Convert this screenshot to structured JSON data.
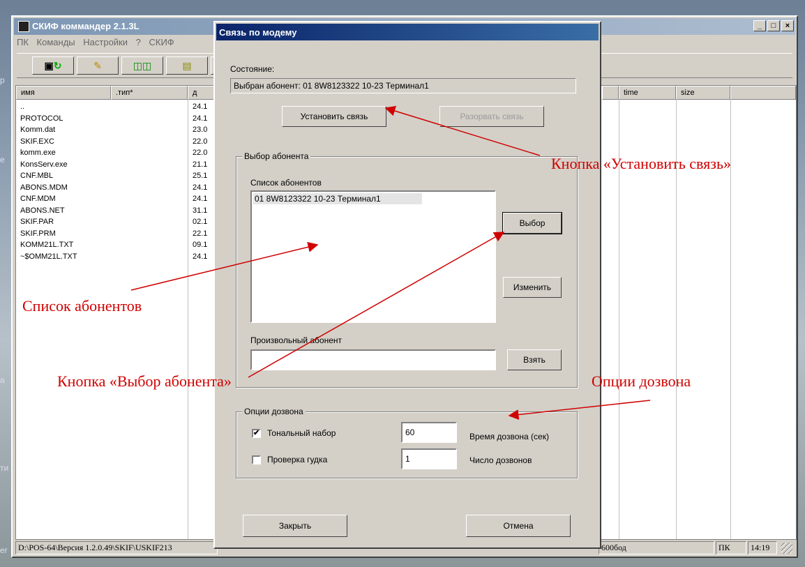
{
  "desktop": {
    "labels": [
      "р",
      "е",
      "а",
      "ти",
      "er"
    ]
  },
  "main_window": {
    "title": "СКИФ коммандер 2.1.3L",
    "controls": [
      "_",
      "□",
      "×"
    ],
    "menu": [
      "ПК",
      "Команды",
      "Настройки",
      "?",
      "СКИФ"
    ],
    "toolbar_icons": [
      "refresh-icon",
      "edit-icon",
      "copy-icon",
      "document-icon"
    ],
    "columns": {
      "name": "имя",
      "type": ".тип*",
      "date": "д",
      "time": "time",
      "size": "size"
    },
    "files": [
      {
        "name": "..",
        "date": "24.1"
      },
      {
        "name": "PROTOCOL",
        "date": "24.1"
      },
      {
        "name": "Komm.dat",
        "date": "23.0"
      },
      {
        "name": "SKIF.EXC",
        "date": "22.0"
      },
      {
        "name": "komm.exe",
        "date": "22.0"
      },
      {
        "name": "KonsServ.exe",
        "date": "21.1"
      },
      {
        "name": "CNF.MBL",
        "date": "25.1"
      },
      {
        "name": "ABONS.MDM",
        "date": "24.1"
      },
      {
        "name": "CNF.MDM",
        "date": "24.1"
      },
      {
        "name": "ABONS.NET",
        "date": "31.1"
      },
      {
        "name": "SKIF.PAR",
        "date": "02.1"
      },
      {
        "name": "SKIF.PRM",
        "date": "22.1"
      },
      {
        "name": "KOMM21L.TXT",
        "date": "09.1"
      },
      {
        "name": "~$OMM21L.TXT",
        "date": "24.1"
      }
    ],
    "status": {
      "path": "D:\\POS-64\\Версия 1.2.0.49\\SKIF\\USKIF213",
      "baud": "600бод",
      "mode": "ПК",
      "clock": "14:19"
    }
  },
  "dialog": {
    "title": "Связь по модему",
    "state_label": "Состояние:",
    "state_value": "Выбран абонент:  01 8W8123322 10-23 Терминал1",
    "connect_button": "Установить связь",
    "disconnect_button": "Разорвать связь",
    "subscriber_group": {
      "title": "Выбор абонента",
      "list_label": "Список абонентов",
      "items": [
        "01 8W8123322 10-23 Терминал1"
      ],
      "select_button": "Выбор",
      "edit_button": "Изменить",
      "custom_label": "Произвольный абонент",
      "custom_value": "",
      "take_button": "Взять"
    },
    "dial_group": {
      "title": "Опции дозвона",
      "tone_label": "Тональный набор",
      "tone_checked": true,
      "tone_mark": "✔",
      "beep_label": "Проверка гудка",
      "beep_checked": false,
      "dial_time_value": "60",
      "dial_time_label": "Время дозвона (сек)",
      "dial_count_value": "1",
      "dial_count_label": "Число дозвонов"
    },
    "close_button": "Закрыть",
    "cancel_button": "Отмена"
  },
  "annotations": {
    "connect": "Кнопка «Установить связь»",
    "list": "Список абонентов",
    "select": "Кнопка «Выбор абонента»",
    "dial": "Опции дозвона"
  },
  "colors": {
    "annotation": "#d00000",
    "dialog_title": "#0a246a",
    "window_face": "#d4d0c8"
  }
}
